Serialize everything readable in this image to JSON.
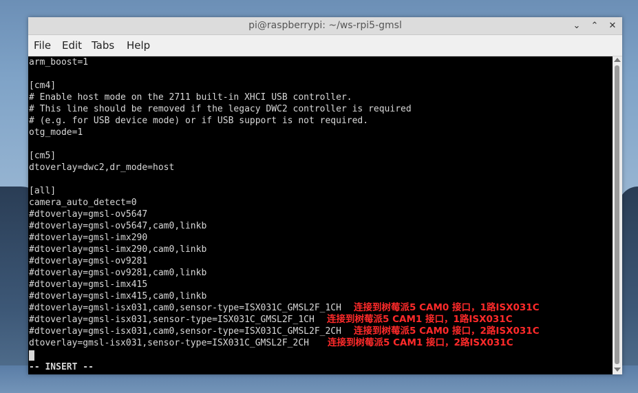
{
  "window": {
    "title": "pi@raspberrypi: ~/ws-rpi5-gmsl",
    "controls": {
      "minimize": "⌄",
      "maximize": "⌃",
      "close": "✕"
    }
  },
  "menu": {
    "file": "File",
    "edit": "Edit",
    "tabs": "Tabs",
    "help": "Help"
  },
  "terminal": {
    "lines": [
      "arm_boost=1",
      "",
      "[cm4]",
      "# Enable host mode on the 2711 built-in XHCI USB controller.",
      "# This line should be removed if the legacy DWC2 controller is required",
      "# (e.g. for USB device mode) or if USB support is not required.",
      "otg_mode=1",
      "",
      "[cm5]",
      "dtoverlay=dwc2,dr_mode=host",
      "",
      "[all]",
      "camera_auto_detect=0",
      "#dtoverlay=gmsl-ov5647",
      "#dtoverlay=gmsl-ov5647,cam0,linkb",
      "#dtoverlay=gmsl-imx290",
      "#dtoverlay=gmsl-imx290,cam0,linkb",
      "#dtoverlay=gmsl-ov9281",
      "#dtoverlay=gmsl-ov9281,cam0,linkb",
      "#dtoverlay=gmsl-imx415",
      "#dtoverlay=gmsl-imx415,cam0,linkb",
      "#dtoverlay=gmsl-isx031,cam0,sensor-type=ISX031C_GMSL2F_1CH",
      "#dtoverlay=gmsl-isx031,sensor-type=ISX031C_GMSL2F_1CH",
      "#dtoverlay=gmsl-isx031,cam0,sensor-type=ISX031C_GMSL2F_2CH",
      "dtoverlay=gmsl-isx031,sensor-type=ISX031C_GMSL2F_2CH"
    ],
    "status": "-- INSERT --"
  },
  "annotations": [
    "连接到树莓派5 CAM0 接口，1路ISX031C",
    "连接到树莓派5 CAM1 接口，1路ISX031C",
    "连接到树莓派5 CAM0 接口，2路ISX031C",
    "连接到树莓派5 CAM1 接口，2路ISX031C"
  ],
  "colors": {
    "terminal_bg": "#000000",
    "terminal_fg": "#d8d8d8",
    "annotation": "#ff2a2a",
    "titlebar": "#dcdcdc"
  }
}
